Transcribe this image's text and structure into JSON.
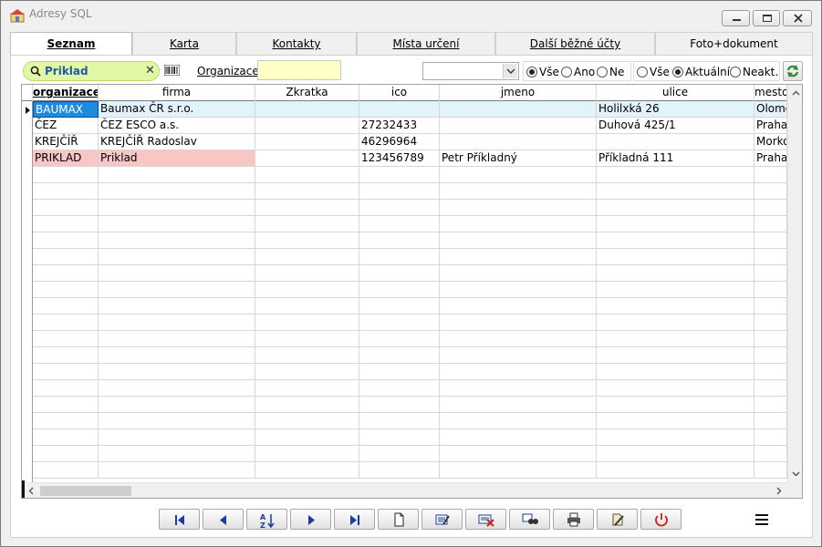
{
  "window": {
    "title": "Adresy SQL"
  },
  "tabs": [
    {
      "label": "Seznam",
      "active": true
    },
    {
      "label": "Karta"
    },
    {
      "label": "Kontakty"
    },
    {
      "label": "Místa určení"
    },
    {
      "label": "Další běžné účty"
    },
    {
      "label": "Foto+dokument"
    }
  ],
  "filter": {
    "search_value": "Priklad",
    "organizace_label": "Organizace",
    "organizace_value": "",
    "combo_value": "",
    "group1": [
      {
        "label": "Vše",
        "checked": true
      },
      {
        "label": "Ano",
        "checked": false
      },
      {
        "label": "Ne",
        "checked": false
      }
    ],
    "group2": [
      {
        "label": "Vše",
        "checked": false
      },
      {
        "label": "Aktuální",
        "checked": true
      },
      {
        "label": "Neakt.",
        "checked": false
      }
    ]
  },
  "grid": {
    "columns": [
      "organizace",
      "firma",
      "Zkratka",
      "ico",
      "jmeno",
      "ulice",
      "mesto"
    ],
    "sorted_column": "organizace",
    "rows": [
      [
        "BAUMAX",
        "Baumax ČR s.r.o.",
        "",
        "",
        "",
        "Holilxká 26",
        "Olomo"
      ],
      [
        "ČEZ",
        "ČEZ ESCO a.s.",
        "",
        "27232433",
        "",
        "Duhová 425/1",
        "Praha"
      ],
      [
        "KREJČÍŘ",
        "KREJČÍŘ Radoslav",
        "",
        "46296964",
        "",
        "",
        "Morkov"
      ],
      [
        "PRIKLAD",
        "Priklad",
        "",
        "123456789",
        "Petr Příkladný",
        "Příkladná 111",
        "Praha"
      ]
    ],
    "selected_row": 0,
    "highlight_row": 3
  },
  "colors": {
    "search_bg": "#e2f7a6",
    "org_input_bg": "#ffffc8",
    "selected_cell": "#1f8be0",
    "highlight_row": "#f9c6c6"
  },
  "toolbar": {
    "icons": [
      "first-record-icon",
      "previous-record-icon",
      "sort-icon",
      "next-record-icon",
      "last-record-icon",
      "new-record-icon",
      "edit-record-icon",
      "delete-record-icon",
      "find-icon",
      "print-icon",
      "export-icon",
      "exit-icon"
    ]
  }
}
